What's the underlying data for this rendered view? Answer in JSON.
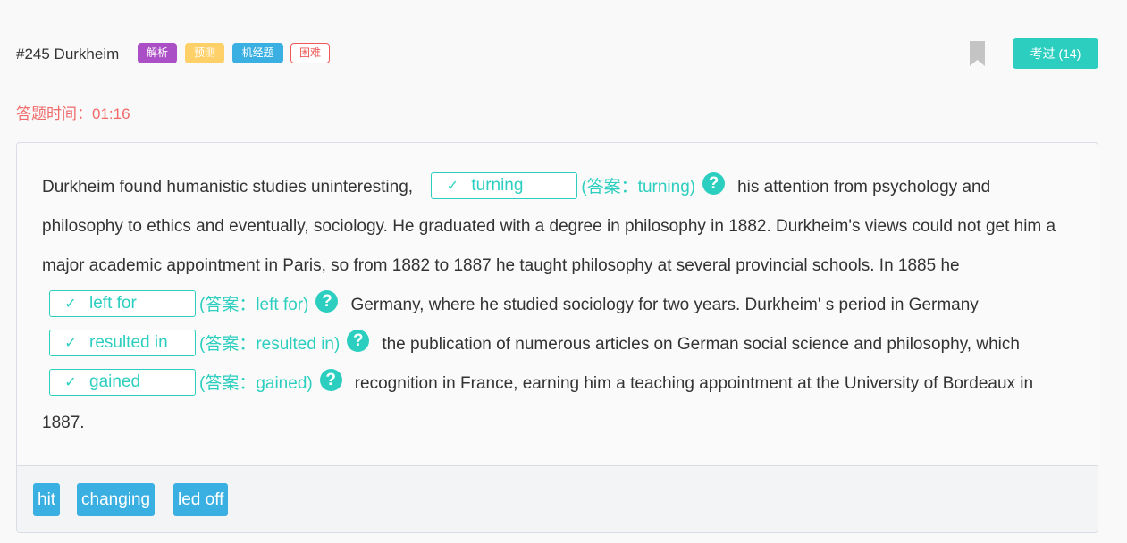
{
  "header": {
    "title": "#245 Durkheim",
    "tags": [
      "解析",
      "预测",
      "机经题",
      "困难"
    ],
    "done_label": "考过 (14)"
  },
  "timer": {
    "label": "答题时间：01:16"
  },
  "passage": {
    "p0": "Durkheim found humanistic studies uninteresting,",
    "p1": "his attention from psychology and philosophy to ethics and eventually, sociology. He graduated with a degree in philosophy in 1882. Durkheim's views could not get him a major academic appointment in Paris, so from 1882 to 1887 he taught philosophy at several provincial schools. In 1885 he",
    "p2": "Germany, where he studied sociology for two years. Durkheim' s period in Germany",
    "p3": "the publication of numerous articles on German social science and philosophy, which",
    "p4": "recognition in France, earning him a teaching appointment at the University of Bordeaux in 1887.",
    "blanks": [
      {
        "check": "✓",
        "value": "turning",
        "answer": "(答案：turning)"
      },
      {
        "check": "✓",
        "value": "left for",
        "answer": "(答案：left for)"
      },
      {
        "check": "✓",
        "value": "resulted in",
        "answer": "(答案：resulted in)"
      },
      {
        "check": "✓",
        "value": "gained",
        "answer": "(答案：gained)"
      }
    ],
    "help_glyph": "?"
  },
  "options": [
    "hit",
    "changing",
    "led off"
  ],
  "colors": {
    "accent": "#2ccfbf",
    "option_bg": "#3ab0e2",
    "timer": "#f06a6a",
    "tag_analysis": "#ab4fc6",
    "tag_predict": "#ffd067",
    "tag_exam": "#3ab0e2",
    "tag_hard": "#f05a5a"
  }
}
